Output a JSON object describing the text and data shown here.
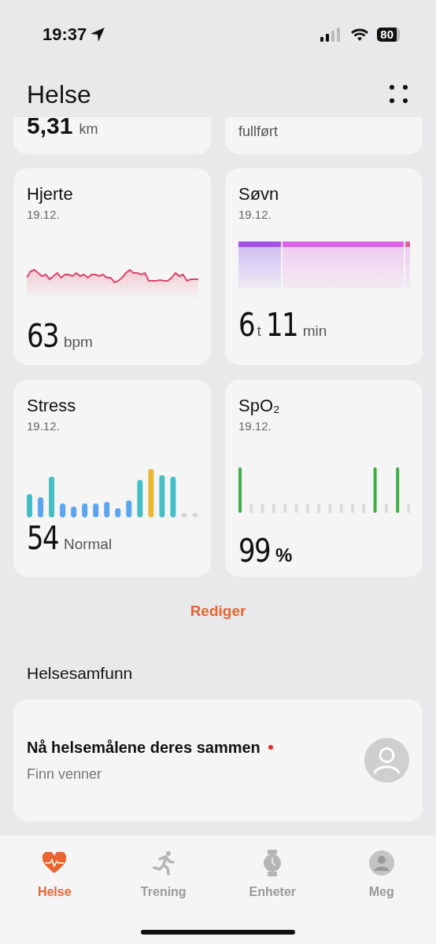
{
  "status_bar": {
    "time": "19:37",
    "battery": "80"
  },
  "header": {
    "title": "Helse"
  },
  "top_cards": [
    {
      "value": "5,31",
      "unit": "km"
    },
    {
      "caption": "fullført"
    }
  ],
  "cards": [
    {
      "kind": "heart",
      "title": "Hjerte",
      "date": "19.12.",
      "value_parts": [
        {
          "text": "63",
          "kind": "number"
        },
        {
          "text": "bpm",
          "kind": "unit"
        }
      ]
    },
    {
      "kind": "sleep",
      "title": "Søvn",
      "date": "19.12.",
      "value_parts": [
        {
          "text": "6",
          "kind": "number"
        },
        {
          "text": "t",
          "kind": "unit"
        },
        {
          "text": "11",
          "kind": "number"
        },
        {
          "text": "min",
          "kind": "unit"
        }
      ]
    },
    {
      "kind": "stress",
      "title": "Stress",
      "date": "19.12.",
      "value_parts": [
        {
          "text": "54",
          "kind": "number"
        },
        {
          "text": "Normal",
          "kind": "unit"
        }
      ]
    },
    {
      "kind": "spo2",
      "title": "SpO₂",
      "date": "19.12.",
      "value_parts": [
        {
          "text": "99",
          "kind": "number"
        },
        {
          "text": "%",
          "kind": "symbol"
        }
      ]
    }
  ],
  "edit_link": "Rediger",
  "community": {
    "heading": "Helsesamfunn",
    "title": "Nå helsemålene deres sammen",
    "subtitle": "Finn venner",
    "new_dot": true
  },
  "tabs": [
    {
      "label": "Helse",
      "selected": true
    },
    {
      "label": "Trening",
      "selected": false
    },
    {
      "label": "Enheter",
      "selected": false
    },
    {
      "label": "Meg",
      "selected": false
    }
  ]
}
